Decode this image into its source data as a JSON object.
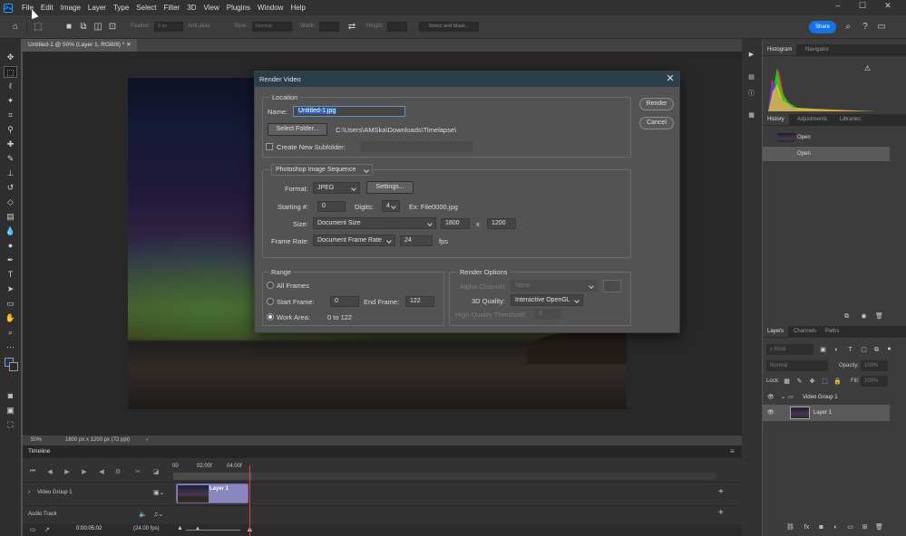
{
  "menubar": {
    "logo": "Ps",
    "items": [
      "File",
      "Edit",
      "Image",
      "Layer",
      "Type",
      "Select",
      "Filter",
      "3D",
      "View",
      "Plugins",
      "Window",
      "Help"
    ]
  },
  "options": {
    "feather_label": "Feather:",
    "feather_value": "0 px",
    "antialias_label": "Anti-alias",
    "style_label": "Style:",
    "style_value": "Normal",
    "width_label": "Width:",
    "height_label": "Height:",
    "select_mask_label": "Select and Mask...",
    "share_label": "Share"
  },
  "document": {
    "tab_title": "Untitled-1 @ 50% (Layer 1, RGB/8) *",
    "zoom": "50%",
    "doc_info": "1800 px x 1200 px (72 ppi)"
  },
  "timeline": {
    "title": "Timeline",
    "ruler": [
      "00",
      "02:00f",
      "04:00f"
    ],
    "video_group": "Video Group 1",
    "clip_label": "Layer 1",
    "audio_track": "Audio Track",
    "current_time": "0:00:05:02",
    "fps": "(24.00 fps)"
  },
  "panels": {
    "histogram_tab": "Histogram",
    "navigator_tab": "Navigator",
    "history_tab": "History",
    "adjustments_tab": "Adjustments",
    "libraries_tab": "Libraries",
    "history_items": [
      "Open",
      "Open"
    ],
    "layers_tab": "Layers",
    "channels_tab": "Channels",
    "paths_tab": "Paths",
    "kind_label": "Kind",
    "blend_mode": "Normal",
    "opacity_label": "Opacity:",
    "opacity_value": "100%",
    "lock_label": "Lock:",
    "fill_label": "Fill:",
    "fill_value": "100%",
    "layers": [
      "Video Group 1",
      "Layer 1"
    ]
  },
  "dialog": {
    "title": "Render Video",
    "render_button": "Render",
    "cancel_button": "Cancel",
    "location_group": "Location",
    "name_label": "Name:",
    "name_value": "Untitled-1.jpg",
    "select_folder_button": "Select Folder...",
    "folder_path": "C:\\Users\\AMSka\\Downloads\\Timelapse\\",
    "create_subfolder_label": "Create New Subfolder:",
    "output_type": "Photoshop Image Sequence",
    "format_label": "Format:",
    "format_value": "JPEG",
    "settings_button": "Settings...",
    "starting_label": "Starting #:",
    "starting_value": "0",
    "digits_label": "Digits:",
    "digits_value": "4",
    "example_text": "Ex: File0000.jpg",
    "size_label": "Size:",
    "size_value": "Document Size",
    "width_value": "1800",
    "x_label": "x",
    "height_value": "1200",
    "frame_rate_label": "Frame Rate:",
    "frame_rate_value": "Document Frame Rate",
    "fps_value": "24",
    "fps_label": "fps",
    "range_group": "Range",
    "all_frames_label": "All Frames",
    "start_frame_label": "Start Frame:",
    "start_frame_value": "0",
    "end_frame_label": "End Frame:",
    "end_frame_value": "122",
    "work_area_label": "Work Area:",
    "work_area_value": "0 to 122",
    "render_options_group": "Render Options",
    "alpha_label": "Alpha Channel:",
    "alpha_value": "None",
    "quality_3d_label": "3D Quality:",
    "quality_3d_value": "Interactive OpenGL",
    "hq_threshold_label": "High Quality Threshold:",
    "hq_threshold_value": "5"
  }
}
